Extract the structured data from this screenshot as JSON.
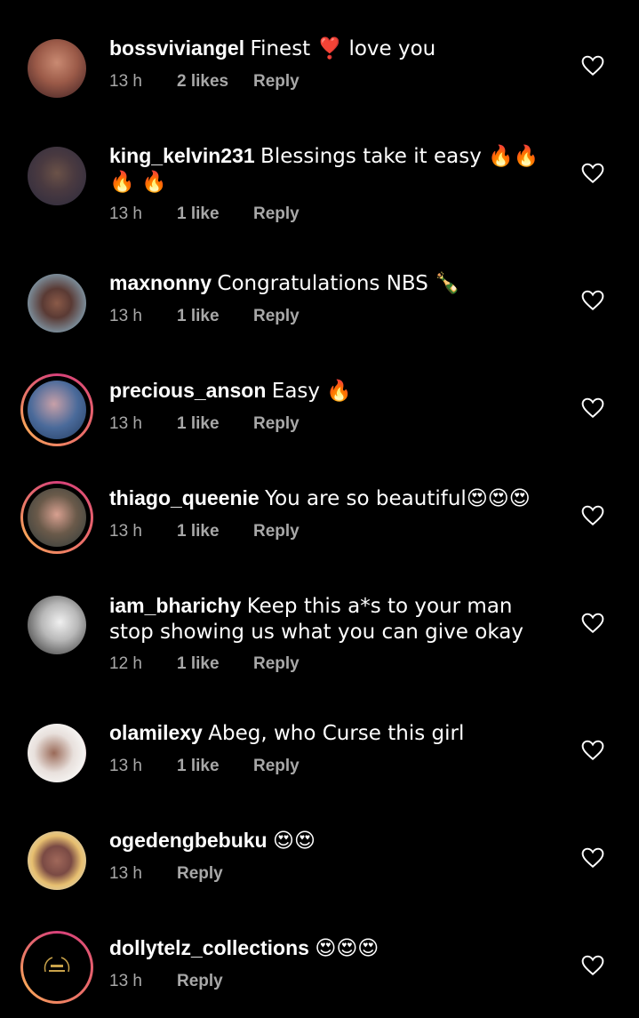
{
  "comments": [
    {
      "username": "bossviviangel",
      "text": "Finest ❣️ love you",
      "time": "13 h",
      "likes": "2 likes",
      "reply": "Reply"
    },
    {
      "username": "king_kelvin231",
      "text": "Blessings take it easy 🔥🔥🔥 🔥",
      "time": "13 h",
      "likes": "1 like",
      "reply": "Reply"
    },
    {
      "username": "maxnonny",
      "text": "Congratulations NBS 🍾",
      "time": "13 h",
      "likes": "1 like",
      "reply": "Reply"
    },
    {
      "username": "precious_anson",
      "text": "Easy 🔥",
      "time": "13 h",
      "likes": "1 like",
      "reply": "Reply"
    },
    {
      "username": "thiago_queenie",
      "text": "You are so beautiful😍😍😍",
      "time": "13 h",
      "likes": "1 like",
      "reply": "Reply"
    },
    {
      "username": "iam_bharichy",
      "text": "Keep this a*s to your man stop showing us what you can give okay",
      "time": "12 h",
      "likes": "1 like",
      "reply": "Reply"
    },
    {
      "username": "olamilexy",
      "text": "Abeg, who Curse this girl",
      "time": "13 h",
      "likes": "1 like",
      "reply": "Reply"
    },
    {
      "username": "ogedengbebuku",
      "text": "😍😍",
      "time": "13 h",
      "likes": "",
      "reply": "Reply"
    },
    {
      "username": "dollytelz_collections",
      "text": "😍😍😍",
      "time": "13 h",
      "likes": "",
      "reply": "Reply"
    }
  ],
  "colors": {
    "background": "#000000",
    "text": "#ffffff",
    "meta": "#a8a8a8",
    "story_ring": "#d7417a"
  },
  "icons": {
    "like": "heart-outline-icon"
  }
}
